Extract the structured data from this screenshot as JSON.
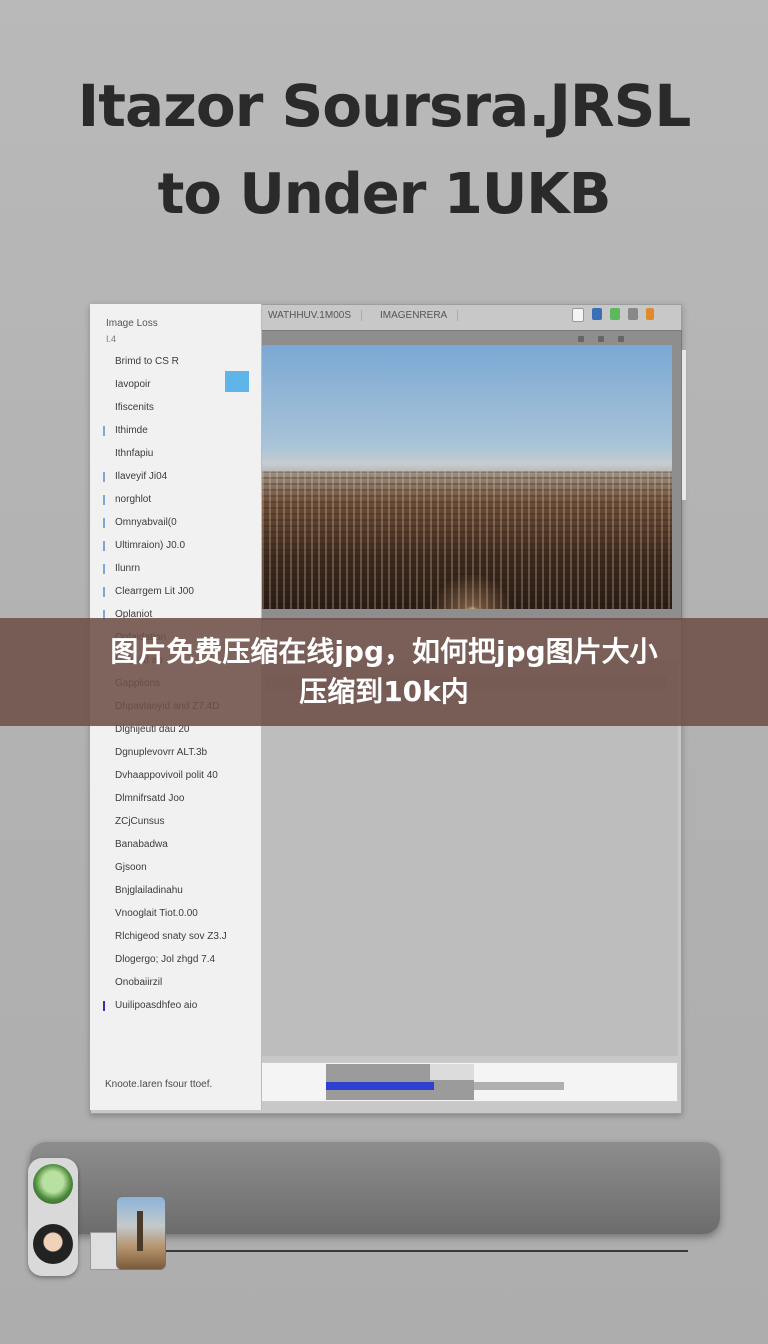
{
  "hero": {
    "line1": "Itazor Soursra.JRSL",
    "line2": "to Under 1UKB"
  },
  "sidebar": {
    "header": "Image Loss",
    "subheader": "I.4",
    "items": [
      {
        "label": "Brimd to CS R",
        "check": "none"
      },
      {
        "label": "Iavopoir",
        "check": "none"
      },
      {
        "label": "Ifiscenits",
        "check": "none"
      },
      {
        "label": "Ithimde",
        "check": "light"
      },
      {
        "label": "Ithnfapiu",
        "check": "none"
      },
      {
        "label": "Ilaveyif Ji04",
        "check": "light"
      },
      {
        "label": "norghlot",
        "check": "light"
      },
      {
        "label": "Omnyabvail(0",
        "check": "light"
      },
      {
        "label": "Ultimraion) J0.0",
        "check": "light"
      },
      {
        "label": "Ilunrn",
        "check": "light"
      },
      {
        "label": "Clearrgem Lit J00",
        "check": "light"
      },
      {
        "label": "Oplaniot",
        "check": "light"
      },
      {
        "label": "Onfaidation",
        "check": "none"
      },
      {
        "label": "Dniplad ao",
        "check": "none"
      },
      {
        "label": "Gapplions",
        "check": "none"
      },
      {
        "label": "Dhpavlaoyid and Z7.4D",
        "check": "none"
      },
      {
        "label": "Dlghijeutl dau 20",
        "check": "none"
      },
      {
        "label": "Dgnuplevovrr ALT.3b",
        "check": "none"
      },
      {
        "label": "Dvhaappovivoil polit 40",
        "check": "none"
      },
      {
        "label": "Dlmnifrsatd Joo",
        "check": "none"
      },
      {
        "label": "ZCjCunsus",
        "check": "none"
      },
      {
        "label": "Banabadwa",
        "check": "none"
      },
      {
        "label": "Gjsoon",
        "check": "none"
      },
      {
        "label": "Bnjglailadinahu",
        "check": "none"
      },
      {
        "label": "Vnooglait Tiot.0.00",
        "check": "none"
      },
      {
        "label": "Rlchigeod snaty sov Z3.J",
        "check": "none"
      },
      {
        "label": "Dlogergo; Jol zhgd 7.4",
        "check": "none"
      },
      {
        "label": "Onobaiirzil",
        "check": "none"
      },
      {
        "label": "Uuilipoasdhfeo aio",
        "check": "dark"
      }
    ],
    "footer": "Knoote.Iaren fsour ttoef."
  },
  "toolbar": {
    "tabs": [
      "WATHHUV.1M00S",
      "IMAGENRERA"
    ]
  },
  "banner": {
    "line1": "图片免费压缩在线jpg，如何把jpg图片大小",
    "line2": "压缩到10k内"
  },
  "progress": {
    "fraction": 0.73
  },
  "icons": {
    "toolbar": [
      "document-icon",
      "lock-icon",
      "check-icon",
      "file-icon",
      "warning-icon"
    ],
    "viewer": [
      "grid-icon",
      "expand-icon",
      "close-icon"
    ]
  }
}
